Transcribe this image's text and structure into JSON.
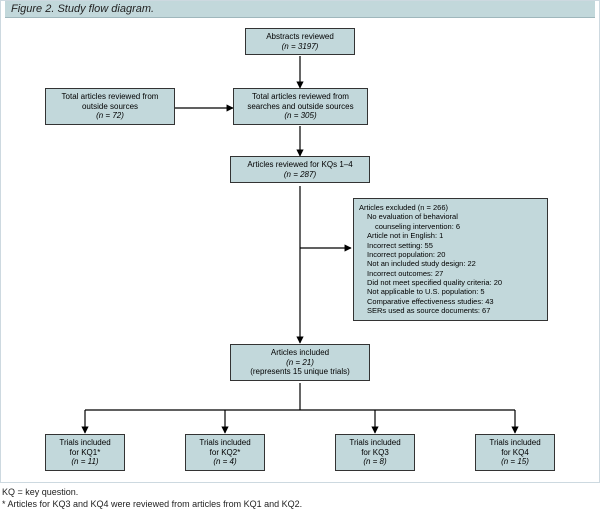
{
  "figure": {
    "title": "Figure 2. Study flow diagram."
  },
  "boxes": {
    "abstracts": {
      "line1": "Abstracts reviewed",
      "line2": "(n = 3197)"
    },
    "outside": {
      "line1": "Total articles reviewed from",
      "line2": "outside sources",
      "line3": "(n = 72)"
    },
    "total": {
      "line1": "Total articles reviewed from",
      "line2": "searches and outside sources",
      "line3": "(n = 305)"
    },
    "kq14": {
      "line1": "Articles reviewed for KQs 1–4",
      "line2": "(n = 287)"
    },
    "excluded": {
      "header": "Articles excluded (n = 266)",
      "r1": "No evaluation of behavioral",
      "r1b": "counseling intervention: 6",
      "r2": "Article not in English: 1",
      "r3": "Incorrect setting: 55",
      "r4": "Incorrect population: 20",
      "r5": "Not an included study design: 22",
      "r6": "Incorrect outcomes: 27",
      "r7": "Did not meet specified quality criteria: 20",
      "r8": "Not applicable to U.S. population: 5",
      "r9": "Comparative effectiveness studies: 43",
      "r10": "SERs used as source documents: 67"
    },
    "included": {
      "line1": "Articles included",
      "line2": "(n = 21)",
      "line3": "(represents 15 unique trials)"
    },
    "kq1": {
      "line1": "Trials included",
      "line2": "for KQ1*",
      "line3": "(n = 11)"
    },
    "kq2": {
      "line1": "Trials included",
      "line2": "for KQ2*",
      "line3": "(n = 4)"
    },
    "kq3": {
      "line1": "Trials included",
      "line2": "for KQ3",
      "line3": "(n = 8)"
    },
    "kq4": {
      "line1": "Trials included",
      "line2": "for KQ4",
      "line3": "(n = 15)"
    }
  },
  "footnote": {
    "line1": "KQ = key question.",
    "line2": "* Articles for KQ3 and KQ4 were reviewed from articles from KQ1 and KQ2."
  },
  "chart_data": {
    "type": "flowchart",
    "title": "Study flow diagram",
    "nodes": [
      {
        "id": "abstracts",
        "label": "Abstracts reviewed",
        "n": 3197
      },
      {
        "id": "outside",
        "label": "Total articles reviewed from outside sources",
        "n": 72
      },
      {
        "id": "total",
        "label": "Total articles reviewed from searches and outside sources",
        "n": 305
      },
      {
        "id": "kq14",
        "label": "Articles reviewed for KQs 1–4",
        "n": 287
      },
      {
        "id": "excluded",
        "label": "Articles excluded",
        "n": 266,
        "reasons": {
          "No evaluation of behavioral counseling intervention": 6,
          "Article not in English": 1,
          "Incorrect setting": 55,
          "Incorrect population": 20,
          "Not an included study design": 22,
          "Incorrect outcomes": 27,
          "Did not meet specified quality criteria": 20,
          "Not applicable to U.S. population": 5,
          "Comparative effectiveness studies": 43,
          "SERs used as source documents": 67
        }
      },
      {
        "id": "included",
        "label": "Articles included (represents 15 unique trials)",
        "n": 21
      },
      {
        "id": "kq1",
        "label": "Trials included for KQ1*",
        "n": 11
      },
      {
        "id": "kq2",
        "label": "Trials included for KQ2*",
        "n": 4
      },
      {
        "id": "kq3",
        "label": "Trials included for KQ3",
        "n": 8
      },
      {
        "id": "kq4",
        "label": "Trials included for KQ4",
        "n": 15
      }
    ],
    "edges": [
      [
        "abstracts",
        "total"
      ],
      [
        "outside",
        "total"
      ],
      [
        "total",
        "kq14"
      ],
      [
        "kq14",
        "excluded"
      ],
      [
        "kq14",
        "included"
      ],
      [
        "included",
        "kq1"
      ],
      [
        "included",
        "kq2"
      ],
      [
        "included",
        "kq3"
      ],
      [
        "included",
        "kq4"
      ]
    ]
  }
}
